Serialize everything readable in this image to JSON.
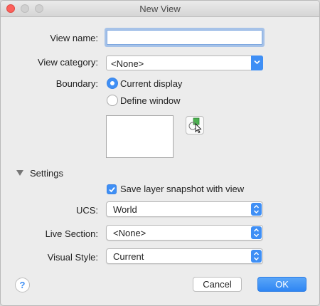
{
  "window": {
    "title": "New View"
  },
  "view_name": {
    "label": "View name:",
    "value": ""
  },
  "view_category": {
    "label": "View category:",
    "value": "<None>"
  },
  "boundary": {
    "label": "Boundary:",
    "options": [
      "Current display",
      "Define window"
    ],
    "selected": "Current display"
  },
  "settings": {
    "label": "Settings",
    "save_snapshot": {
      "label": "Save layer snapshot with view",
      "checked": true
    },
    "ucs": {
      "label": "UCS:",
      "value": "World"
    },
    "live_section": {
      "label": "Live Section:",
      "value": "<None>"
    },
    "visual_style": {
      "label": "Visual Style:",
      "value": "Current"
    }
  },
  "footer": {
    "help": "?",
    "cancel": "Cancel",
    "ok": "OK"
  },
  "colors": {
    "accent": "#3f8ff5",
    "close": "#fc605b"
  }
}
